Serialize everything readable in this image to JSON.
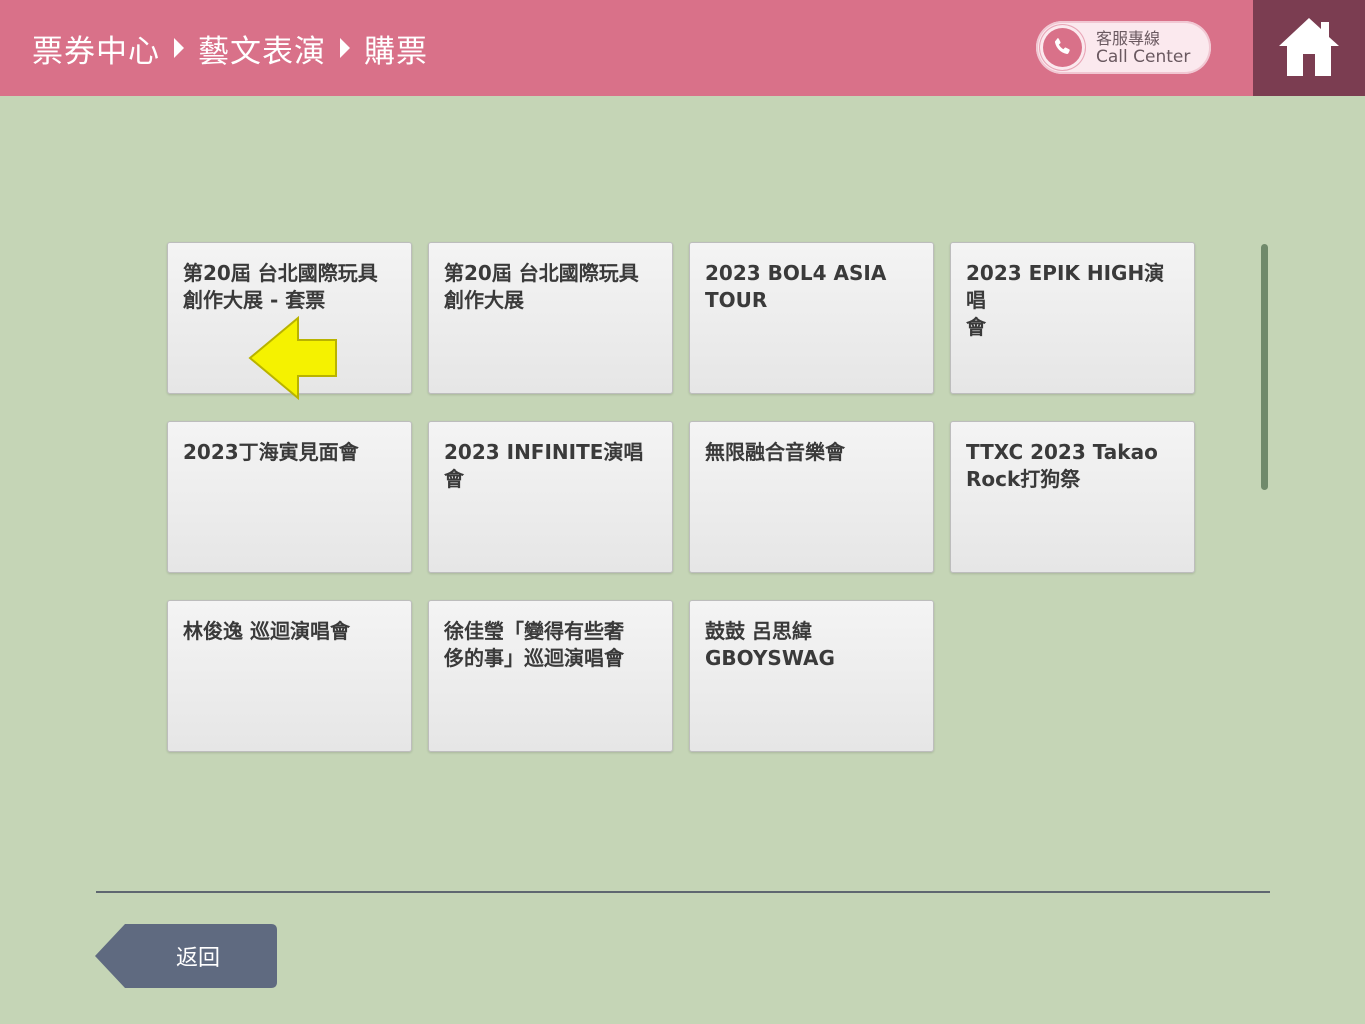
{
  "header": {
    "breadcrumb": [
      "票券中心",
      "藝文表演",
      "購票"
    ],
    "call_center": {
      "label_zh": "客服專線",
      "label_en": "Call Center",
      "icon": "phone-icon"
    },
    "home_icon": "home-icon"
  },
  "events": [
    {
      "label": "第20屆 台北國際玩具\n創作大展 - 套票"
    },
    {
      "label": "第20屆 台北國際玩具\n創作大展"
    },
    {
      "label": "2023 BOL4 ASIA\nTOUR"
    },
    {
      "label": "2023 EPIK HIGH演唱\n會"
    },
    {
      "label": "2023丁海寅見面會"
    },
    {
      "label": "2023 INFINITE演唱會"
    },
    {
      "label": "無限融合音樂會"
    },
    {
      "label": "TTXC 2023 Takao\nRock打狗祭"
    },
    {
      "label": "林俊逸 巡迴演唱會"
    },
    {
      "label": "徐佳瑩「變得有些奢\n侈的事」巡迴演唱會"
    },
    {
      "label": "鼓鼓 呂思緯\nGBOYSWAG"
    }
  ],
  "footer": {
    "back_label": "返回"
  },
  "colors": {
    "header_bg": "#d97189",
    "home_bg": "#7b3d51",
    "page_bg": "#c5d5b6",
    "tile_bg": "#eeeeee",
    "back_button": "#5f6a80",
    "pointer": "#f5f200"
  }
}
